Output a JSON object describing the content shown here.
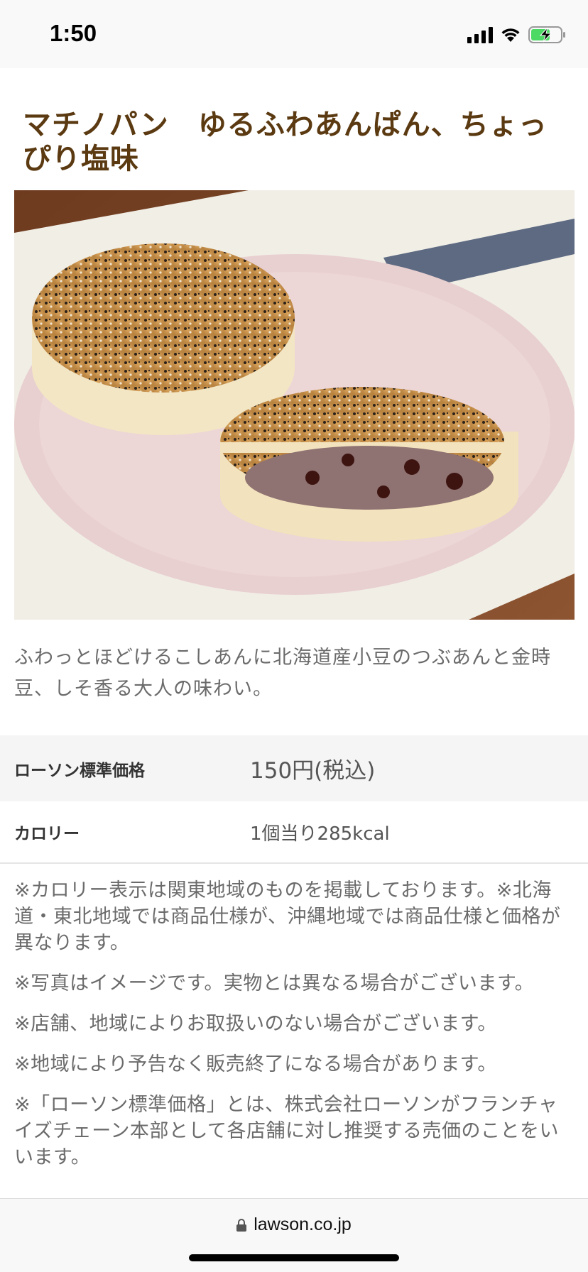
{
  "status_bar": {
    "time": "1:50"
  },
  "product": {
    "title": "マチノパン　ゆるふわあんぱん、ちょっぴり塩味",
    "image_icon": "product-photo",
    "description": "ふわっとほどけるこしあんに北海道産小豆のつぶあんと金時豆、しそ香る大人の味わい。"
  },
  "info": {
    "price_label": "ローソン標準価格",
    "price_value": "150円(税込)",
    "calorie_label": "カロリー",
    "calorie_value": "1個当り285kcal"
  },
  "notes": [
    "※カロリー表示は関東地域のものを掲載しております。※北海道・東北地域では商品仕様が、沖縄地域では商品仕様と価格が異なります。",
    "※写真はイメージです。実物とは異なる場合がございます。",
    "※店舗、地域によりお取扱いのない場合がございます。",
    "※地域により予告なく販売終了になる場合があります。",
    "※「ローソン標準価格」とは、株式会社ローソンがフランチャイズチェーン本部として各店舗に対し推奨する売価のことをいいます。"
  ],
  "browser": {
    "url": "lawson.co.jp",
    "lock_icon": "lock-icon"
  },
  "colors": {
    "title": "#5b3a12",
    "text": "#6b6b6b",
    "price_row_bg": "#f5f5f5"
  }
}
